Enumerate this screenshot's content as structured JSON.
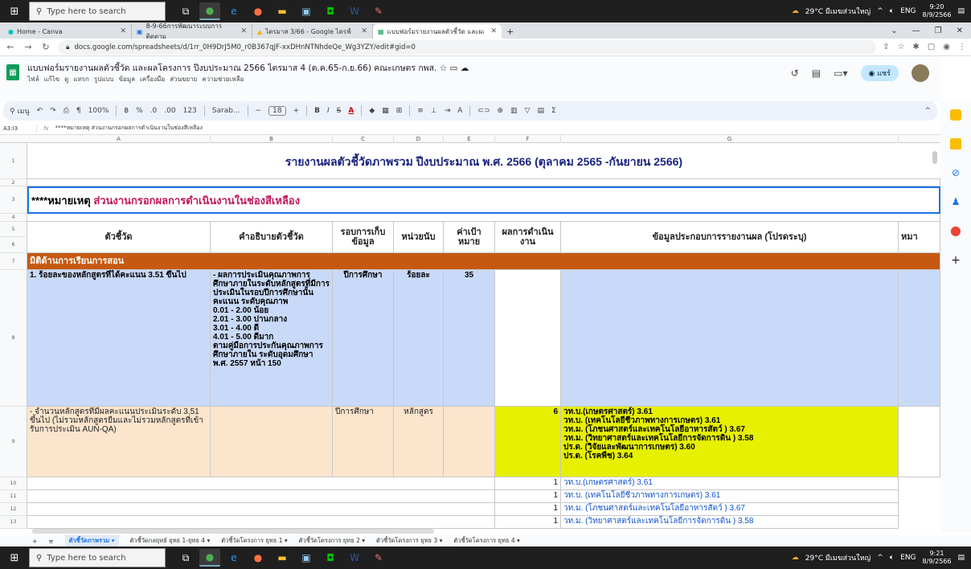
{
  "taskbar_top": {
    "search_placeholder": "Type here to search",
    "weather": "29°C มีเมฆส่วนใหญ่",
    "lang": "ENG",
    "time": "9:20",
    "date": "8/9/2566"
  },
  "taskbar_bottom": {
    "search_placeholder": "Type here to search",
    "weather": "29°C มีเมฆส่วนใหญ่",
    "lang": "ENG",
    "time": "9:21",
    "date": "8/9/2566"
  },
  "browser": {
    "tabs": [
      {
        "label": "Home - Canva"
      },
      {
        "label": "8-9-66การพัฒนาระบบการติดตาม"
      },
      {
        "label": "ไตรมาส 3/66 - Google ไดรฟ์"
      },
      {
        "label": "แบบฟอร์มรายงานผลตัวชี้วัด และผลโครงการ"
      }
    ],
    "url": "docs.google.com/spreadsheets/d/1rr_0H9DrJ5M0_r0B367qJF-xxDHnNTNhdeQe_Wg3YZY/edit#gid=0"
  },
  "doc": {
    "title": "แบบฟอร์มรายงานผลตัวชี้วัด และผลโครงการ ปีงบประมาณ 2566 ไตรมาส 4 (ต.ค.65-ก.ย.66) คณะเกษตร กพส.",
    "menu": [
      "ไฟล์",
      "แก้ไข",
      "ดู",
      "แทรก",
      "รูปแบบ",
      "ข้อมูล",
      "เครื่องมือ",
      "ส่วนขยาย",
      "ความช่วยเหลือ"
    ],
    "share_label": "แชร์"
  },
  "toolbar": {
    "search": "เมนู",
    "zoom": "100%",
    "currency": "฿",
    "percent": "%",
    "dec1": ".0",
    "dec2": ".00",
    "numfmt": "123",
    "font": "Sarab...",
    "font_size": "18",
    "bold": "B",
    "italic": "I",
    "strike": "S",
    "color": "A",
    "sigma": "Σ"
  },
  "formula_bar": {
    "cell_ref": "A3:I3",
    "fx": "fx",
    "content": "****หมายเหตุ ส่วนงานกรอกผลการดำเนินงานในช่องสีเหลือง"
  },
  "columns": [
    "A",
    "B",
    "C",
    "D",
    "E",
    "F",
    "G"
  ],
  "rows": [
    "1",
    "2",
    "3",
    "4",
    "5",
    "6",
    "7",
    "8",
    "9",
    "10",
    "11",
    "12",
    "13"
  ],
  "sheet": {
    "title": "รายงานผลตัวชี้วัดภาพรวม ปีงบประมาณ พ.ศ. 2566 (ตุลาคม 2565 -กันยายน 2566)",
    "note_prefix": "****หมายเหตุ ",
    "note_red": "ส่วนงานกรอกผลการดำเนินงานในช่องสีเหลือง",
    "headers": [
      "ตัวชี้วัด",
      "คำอธิบายตัวชี้วัด",
      "รอบการเก็บข้อมูล",
      "หน่วยนับ",
      "ค่าเป้าหมาย",
      "ผลการดำเนินงาน",
      "ข้อมูลประกอบการรายงานผล (โปรดระบุ)",
      "หมา"
    ],
    "dimension": "มิติด้านการเรียนการสอน",
    "row8": {
      "indicator": "1. ร้อยละของหลักสูตรที่ได้คะแนน 3.51 ขึ้นไป",
      "desc": "- ผลการประเมินคุณภาพการศึกษาภายในระดับหลักสูตรที่มีการประเมินในรอบปีการศึกษานั้น\nคะแนน ระดับคุณภาพ\n0.01 - 2.00 น้อย\n2.01 - 3.00 ปานกลาง\n3.01 - 4.00 ดี\n4.01 - 5.00 ดีมาก\nตามคู่มือการประกันคุณภาพการศึกษาภายใน ระดับอุดมศึกษา พ.ศ. 2557 หน้า 150",
      "cycle": "ปีการศึกษา",
      "unit": "ร้อยละ",
      "target": "35"
    },
    "row9": {
      "indicator": "- จำนวนหลักสูตรที่มีผลคะแนนประเมินระดับ 3.51 ขึ้นไป (ไม่รวมหลักสูตรยืมและไม่รวมหลักสูตรที่เข้ารับการประเมิน AUN-QA)",
      "cycle": "ปีการศึกษา",
      "unit": "หลักสูตร",
      "result": "6",
      "details": "วท.บ.(เกษตรศาสตร์) 3.61\nวท.บ. (เทคโนโลยีชีวภาพทางการเกษตร) 3.61\nวท.ม. (โภชนศาสตร์และเทคโนโลยีอาหารสัตว์ ) 3.67\nวท.ม. (วิทยาศาสตร์และเทคโนโลยีการจัดการดิน ) 3.58\nปร.ด. (วิจัยและพัฒนาการเกษตร) 3.60\nปร.ด. (โรคพืช) 3.64"
    },
    "rows_10_13": [
      {
        "num": "1",
        "text": "วท.บ.(เกษตรศาสตร์) 3.61"
      },
      {
        "num": "1",
        "text": "วท.บ. (เทคโนโลยีชีวภาพทางการเกษตร) 3.61"
      },
      {
        "num": "1",
        "text": "วท.ม. (โภชนศาสตร์และเทคโนโลยีอาหารสัตว์ ) 3.67"
      },
      {
        "num": "1",
        "text": "วท.ม. (วิทยาศาสตร์และเทคโนโลยีการจัดการดิน ) 3.58"
      }
    ]
  },
  "sheet_tabs": [
    "ตัวชี้วัดภาพรวม",
    "ตัวชี้วัดกลยุทธ์ ยุทธ 1-ยุทธ 4",
    "ตัวชี้วัดโครงการ ยุทธ 1",
    "ตัวชี้วัดโครงการ ยุทธ 2",
    "ตัวชี้วัดโครงการ ยุทธ 3",
    "ตัวชี้วัดโครงการ ยุทธ 4"
  ]
}
